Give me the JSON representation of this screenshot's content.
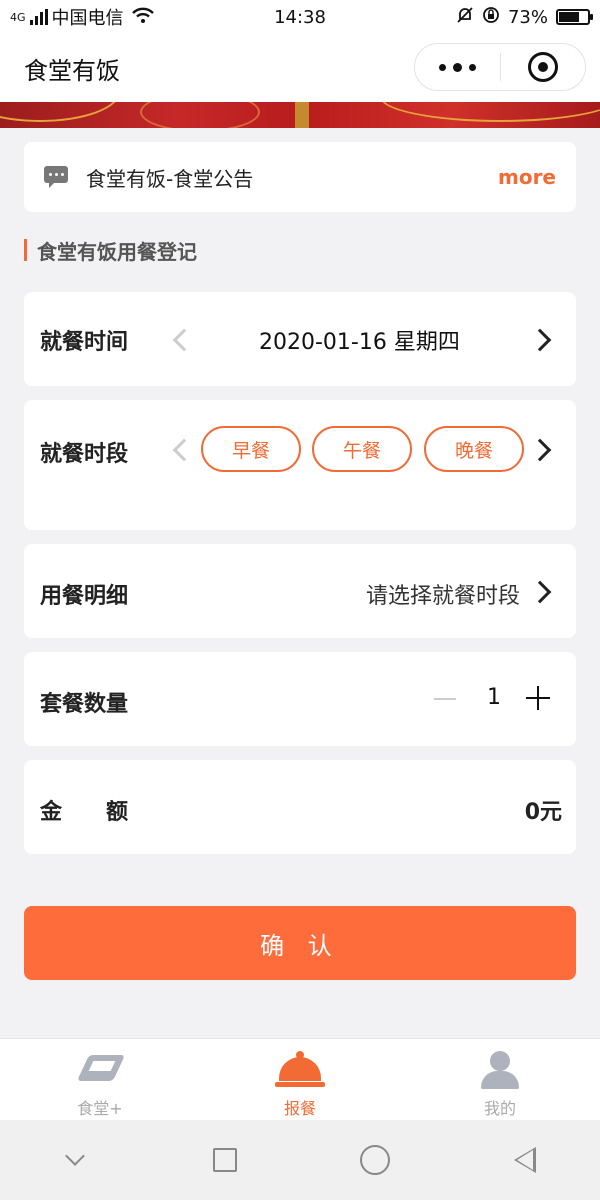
{
  "status_bar": {
    "network": "4G",
    "carrier": "中国电信",
    "time": "14:38",
    "battery": "73%"
  },
  "header": {
    "title": "食堂有饭"
  },
  "notice": {
    "text": "食堂有饭-食堂公告",
    "more": "more"
  },
  "section": {
    "title": "食堂有饭用餐登记"
  },
  "form": {
    "date": {
      "label": "就餐时间",
      "value": "2020-01-16 星期四"
    },
    "period": {
      "label": "就餐时段",
      "options": [
        "早餐",
        "午餐",
        "晚餐"
      ]
    },
    "detail": {
      "label": "用餐明细",
      "value": "请选择就餐时段"
    },
    "quantity": {
      "label": "套餐数量",
      "value": "1"
    },
    "amount": {
      "label": "金　　额",
      "value": "0元"
    }
  },
  "confirm_label": "确 认",
  "tabbar": {
    "items": [
      {
        "label": "食堂+",
        "icon": "handshake-icon",
        "active": false
      },
      {
        "label": "报餐",
        "icon": "food-dome-icon",
        "active": true
      },
      {
        "label": "我的",
        "icon": "person-icon",
        "active": false
      }
    ]
  },
  "colors": {
    "accent": "#f26b35",
    "confirm": "#fe6c3b",
    "background": "#f2f2f4",
    "inactive_tab": "#aaaaaa"
  }
}
